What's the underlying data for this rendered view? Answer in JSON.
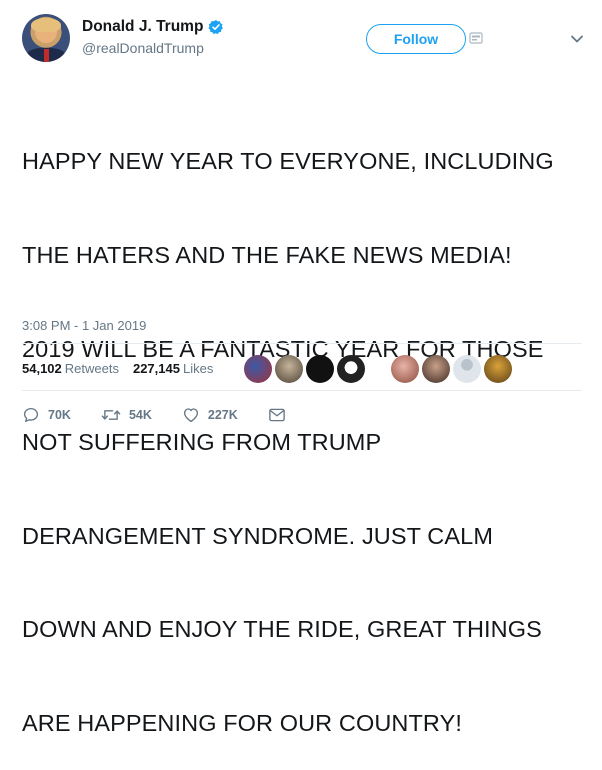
{
  "user": {
    "display_name": "Donald J. Trump",
    "handle": "@realDonaldTrump",
    "verified": true
  },
  "follow_label": "Follow",
  "tweet": {
    "lines": [
      "HAPPY NEW YEAR TO EVERYONE, INCLUDING",
      "THE HATERS AND THE FAKE NEWS MEDIA!",
      "2019 WILL BE A FANTASTIC YEAR FOR THOSE",
      "NOT SUFFERING FROM TRUMP",
      "DERANGEMENT SYNDROME. JUST CALM",
      "DOWN AND ENJOY THE RIDE, GREAT THINGS",
      "ARE HAPPENING FOR OUR COUNTRY!"
    ],
    "timestamp": "3:08 PM - 1 Jan 2019"
  },
  "stats": {
    "retweets_count": "54,102",
    "retweets_label": "Retweets",
    "likes_count": "227,145",
    "likes_label": "Likes"
  },
  "actions": {
    "reply_count": "70K",
    "retweet_count": "54K",
    "like_count": "227K"
  },
  "colors": {
    "accent": "#1da1f2",
    "secondary_text": "#657786",
    "divider": "#e6ecf0"
  },
  "icons": [
    "verified-badge-icon",
    "external-link-icon",
    "chevron-down-icon",
    "reply-icon",
    "retweet-icon",
    "like-icon",
    "message-icon"
  ]
}
